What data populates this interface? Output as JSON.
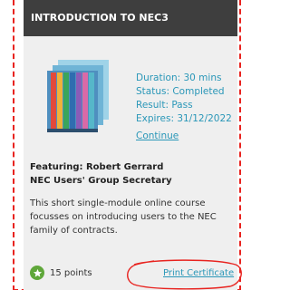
{
  "card": {
    "title": "INTRODUCTION TO NEC3",
    "meta": {
      "duration": "Duration: 30 mins",
      "status": "Status: Completed",
      "result": "Result: Pass",
      "expires": "Expires: 31/12/2022"
    },
    "continue_label": "Continue",
    "featuring": {
      "line1": "Featuring: Robert Gerrard",
      "line2": "NEC Users' Group Secretary"
    },
    "description": {
      "line1": "This short single-module online course",
      "line2": "focusses on introducing users to the NEC",
      "line3": "family of contracts."
    },
    "points_label": "15 points",
    "print_label": "Print Certificate",
    "icons": {
      "points": "star-icon",
      "thumbnail": "contract-books-image"
    }
  },
  "colors": {
    "header_bg": "#3e3e3e",
    "card_bg": "#efefef",
    "accent_link": "#2a97b8",
    "annotation_red": "#e8231f",
    "points_green": "#5fa73a"
  }
}
